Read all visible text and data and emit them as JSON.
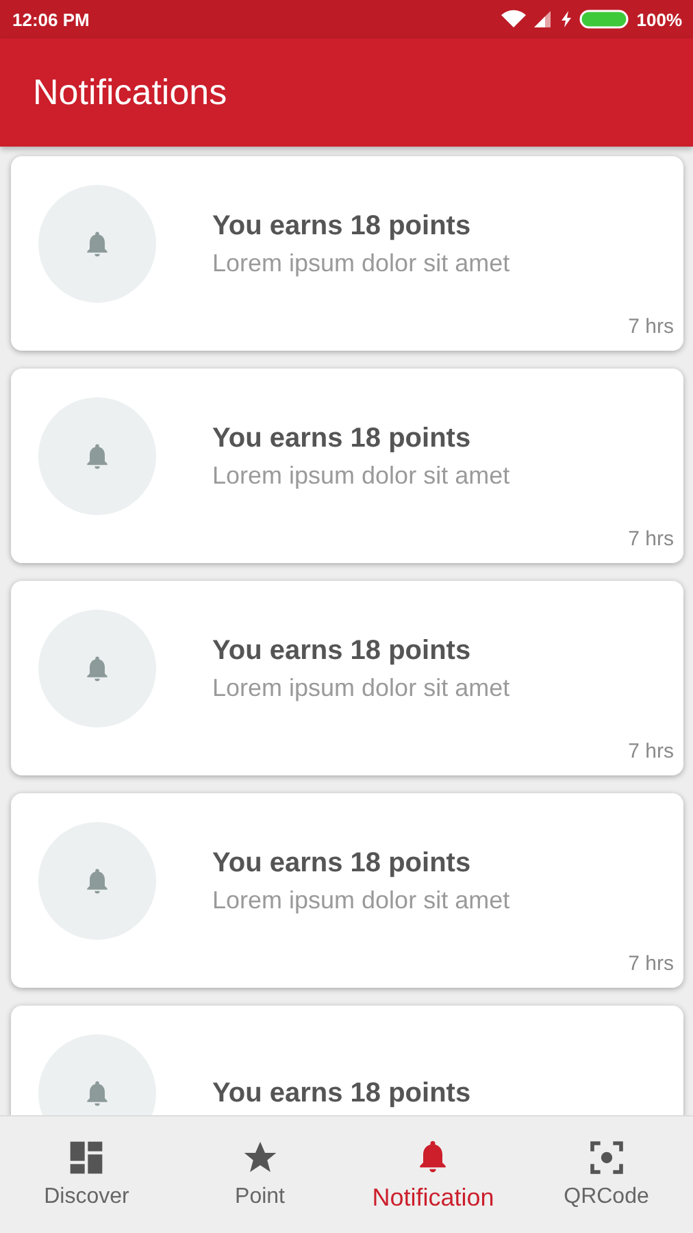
{
  "status_bar": {
    "time": "12:06 PM",
    "battery": "100%"
  },
  "app_bar": {
    "title": "Notifications"
  },
  "notifications": [
    {
      "title": "You earns 18 points",
      "message": "Lorem ipsum dolor sit amet",
      "time": "7 hrs"
    },
    {
      "title": "You earns 18 points",
      "message": "Lorem ipsum dolor sit amet",
      "time": "7 hrs"
    },
    {
      "title": "You earns 18 points",
      "message": "Lorem ipsum dolor sit amet",
      "time": "7 hrs"
    },
    {
      "title": "You earns 18 points",
      "message": "Lorem ipsum dolor sit amet",
      "time": "7 hrs"
    },
    {
      "title": "You earns 18 points"
    }
  ],
  "bottom_nav": [
    {
      "label": "Discover",
      "kind": "grid",
      "selected": false
    },
    {
      "label": "Point",
      "kind": "star",
      "selected": false
    },
    {
      "label": "Notification",
      "kind": "bell",
      "selected": true
    },
    {
      "label": "QRCode",
      "kind": "scan",
      "selected": false
    }
  ]
}
